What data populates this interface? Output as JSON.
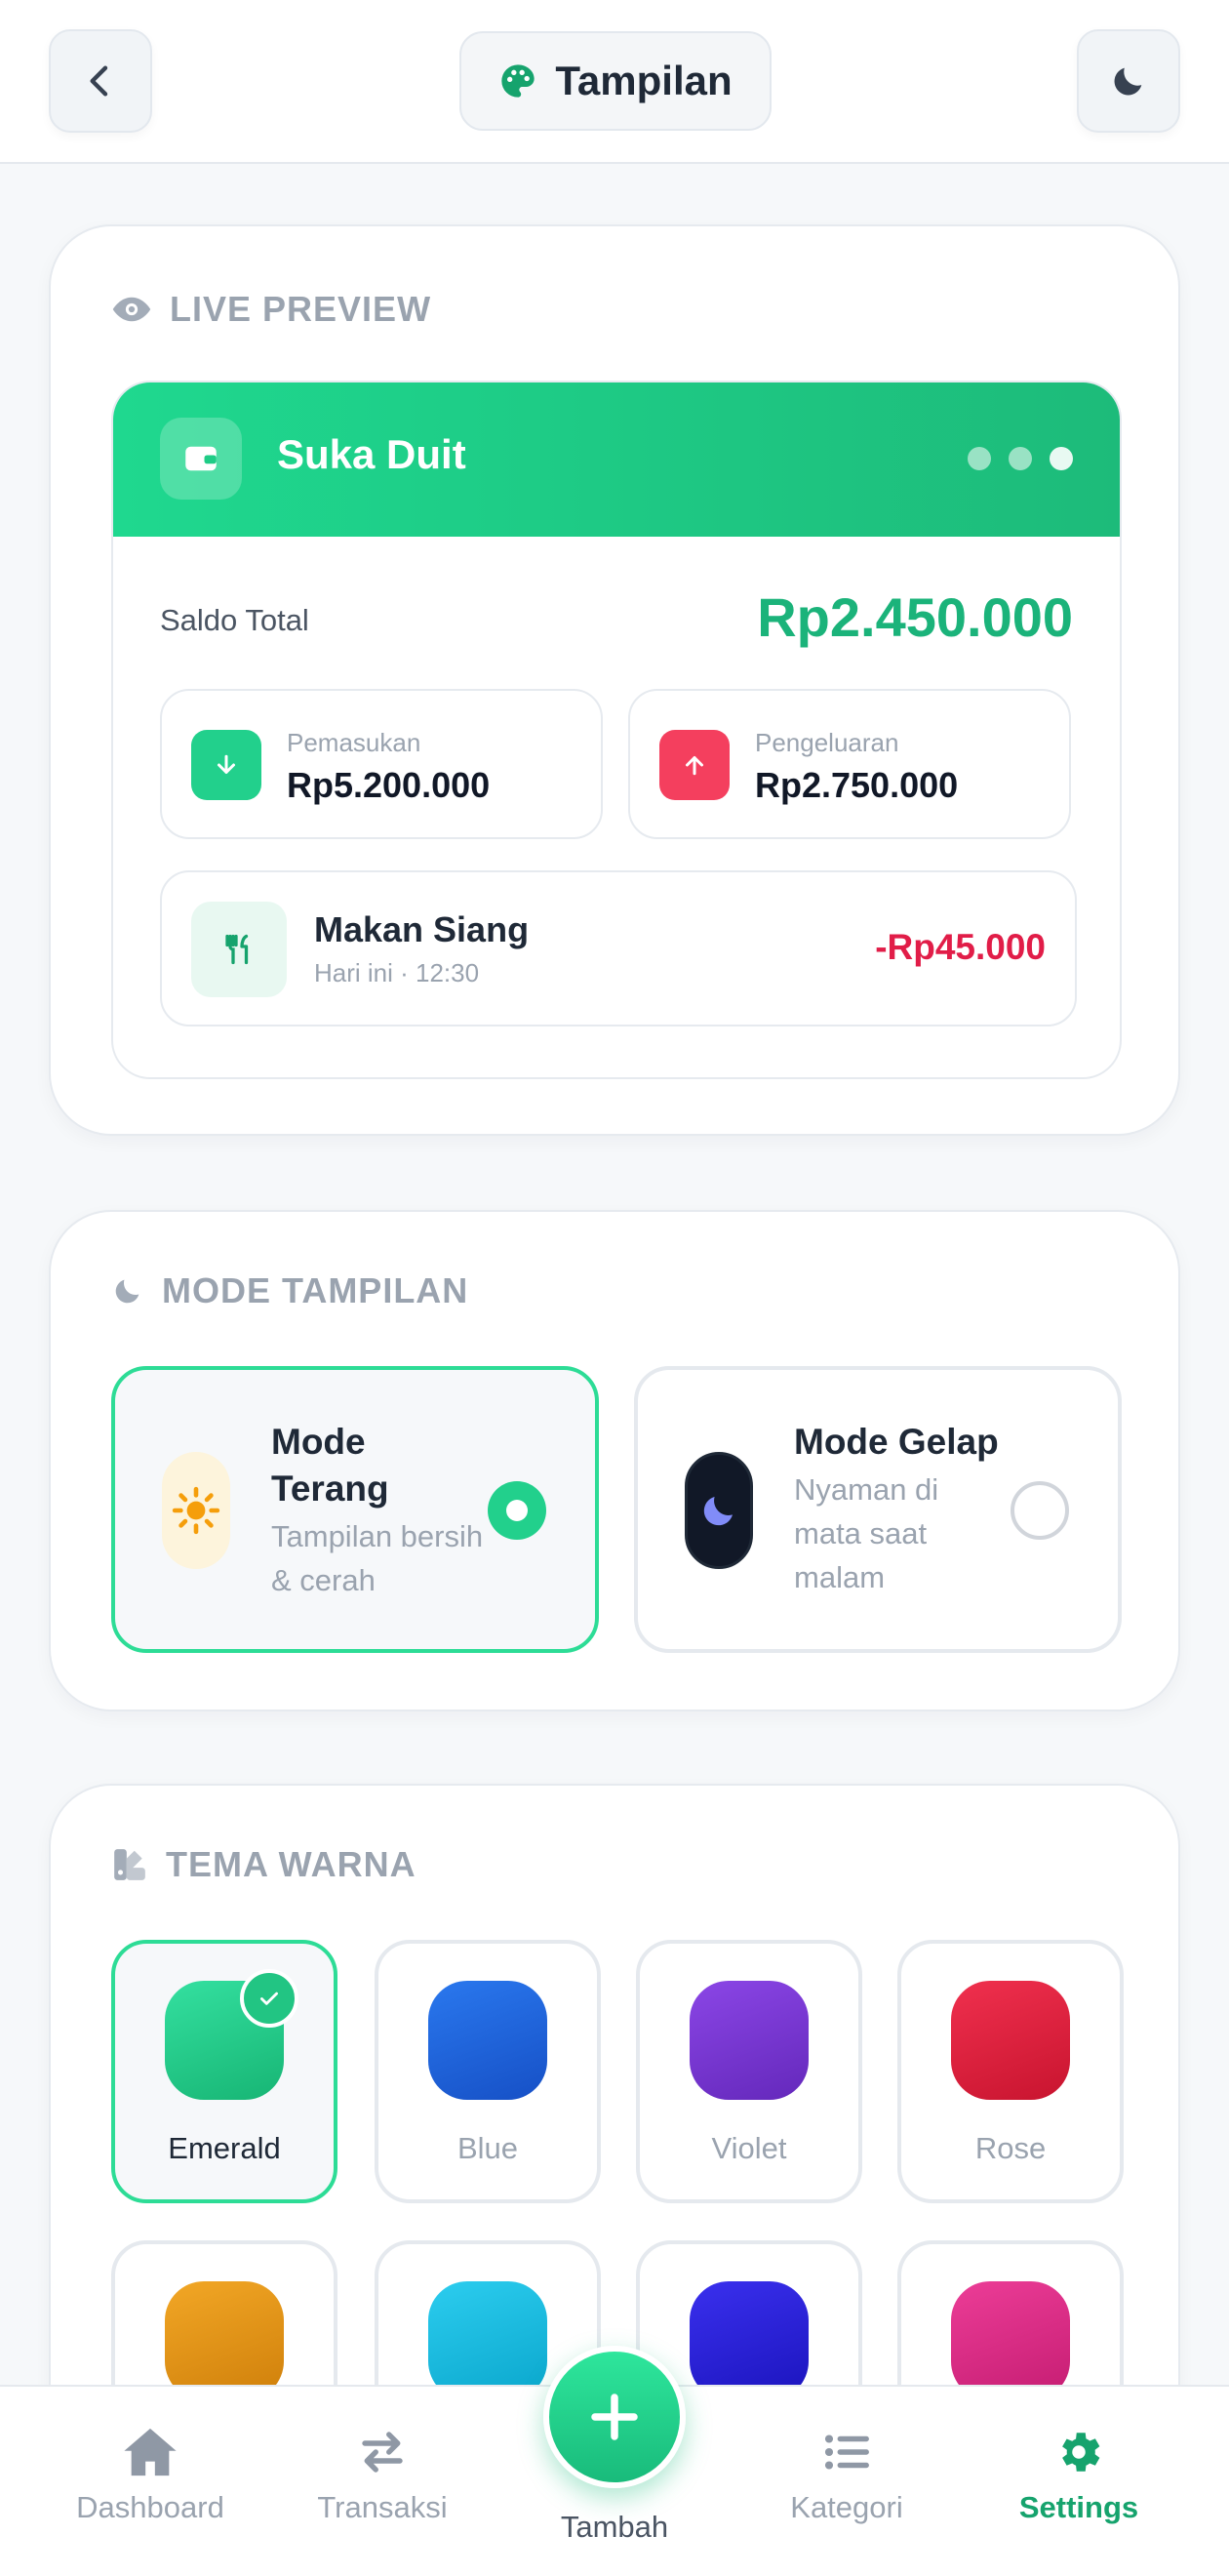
{
  "header": {
    "title": "Tampilan",
    "back_icon": "chevron-left-icon",
    "palette_icon": "palette-icon",
    "dark_toggle_icon": "moon-icon"
  },
  "preview": {
    "section_title": "LIVE PREVIEW",
    "app_name": "Suka Duit",
    "saldo_label": "Saldo Total",
    "saldo_value": "Rp2.450.000",
    "income_label": "Pemasukan",
    "income_value": "Rp5.200.000",
    "expense_label": "Pengeluaran",
    "expense_value": "Rp2.750.000",
    "tx_name": "Makan Siang",
    "tx_time": "Hari ini · 12:30",
    "tx_amount": "-Rp45.000"
  },
  "mode": {
    "section_title": "MODE TAMPILAN",
    "light_title": "Mode Terang",
    "light_desc": "Tampilan bersih & cerah",
    "dark_title": "Mode Gelap",
    "dark_desc": "Nyaman di mata saat malam",
    "selected": "light"
  },
  "theme": {
    "section_title": "TEMA WARNA",
    "swatches": [
      {
        "name": "Emerald",
        "color": "#22c583",
        "selected": true
      },
      {
        "name": "Blue",
        "color": "#1d64d8"
      },
      {
        "name": "Violet",
        "color": "#7635cf"
      },
      {
        "name": "Rose",
        "color": "#e01b3c"
      },
      {
        "name": "",
        "color": "#e09414"
      },
      {
        "name": "",
        "color": "#14b9df"
      },
      {
        "name": "",
        "color": "#2520d6"
      },
      {
        "name": "",
        "color": "#db2a85"
      }
    ]
  },
  "nav": {
    "dashboard": "Dashboard",
    "transaksi": "Transaksi",
    "tambah": "Tambah",
    "kategori": "Kategori",
    "settings": "Settings"
  },
  "colors": {
    "accent": "#1bb37a",
    "expense": "#e11d48"
  }
}
